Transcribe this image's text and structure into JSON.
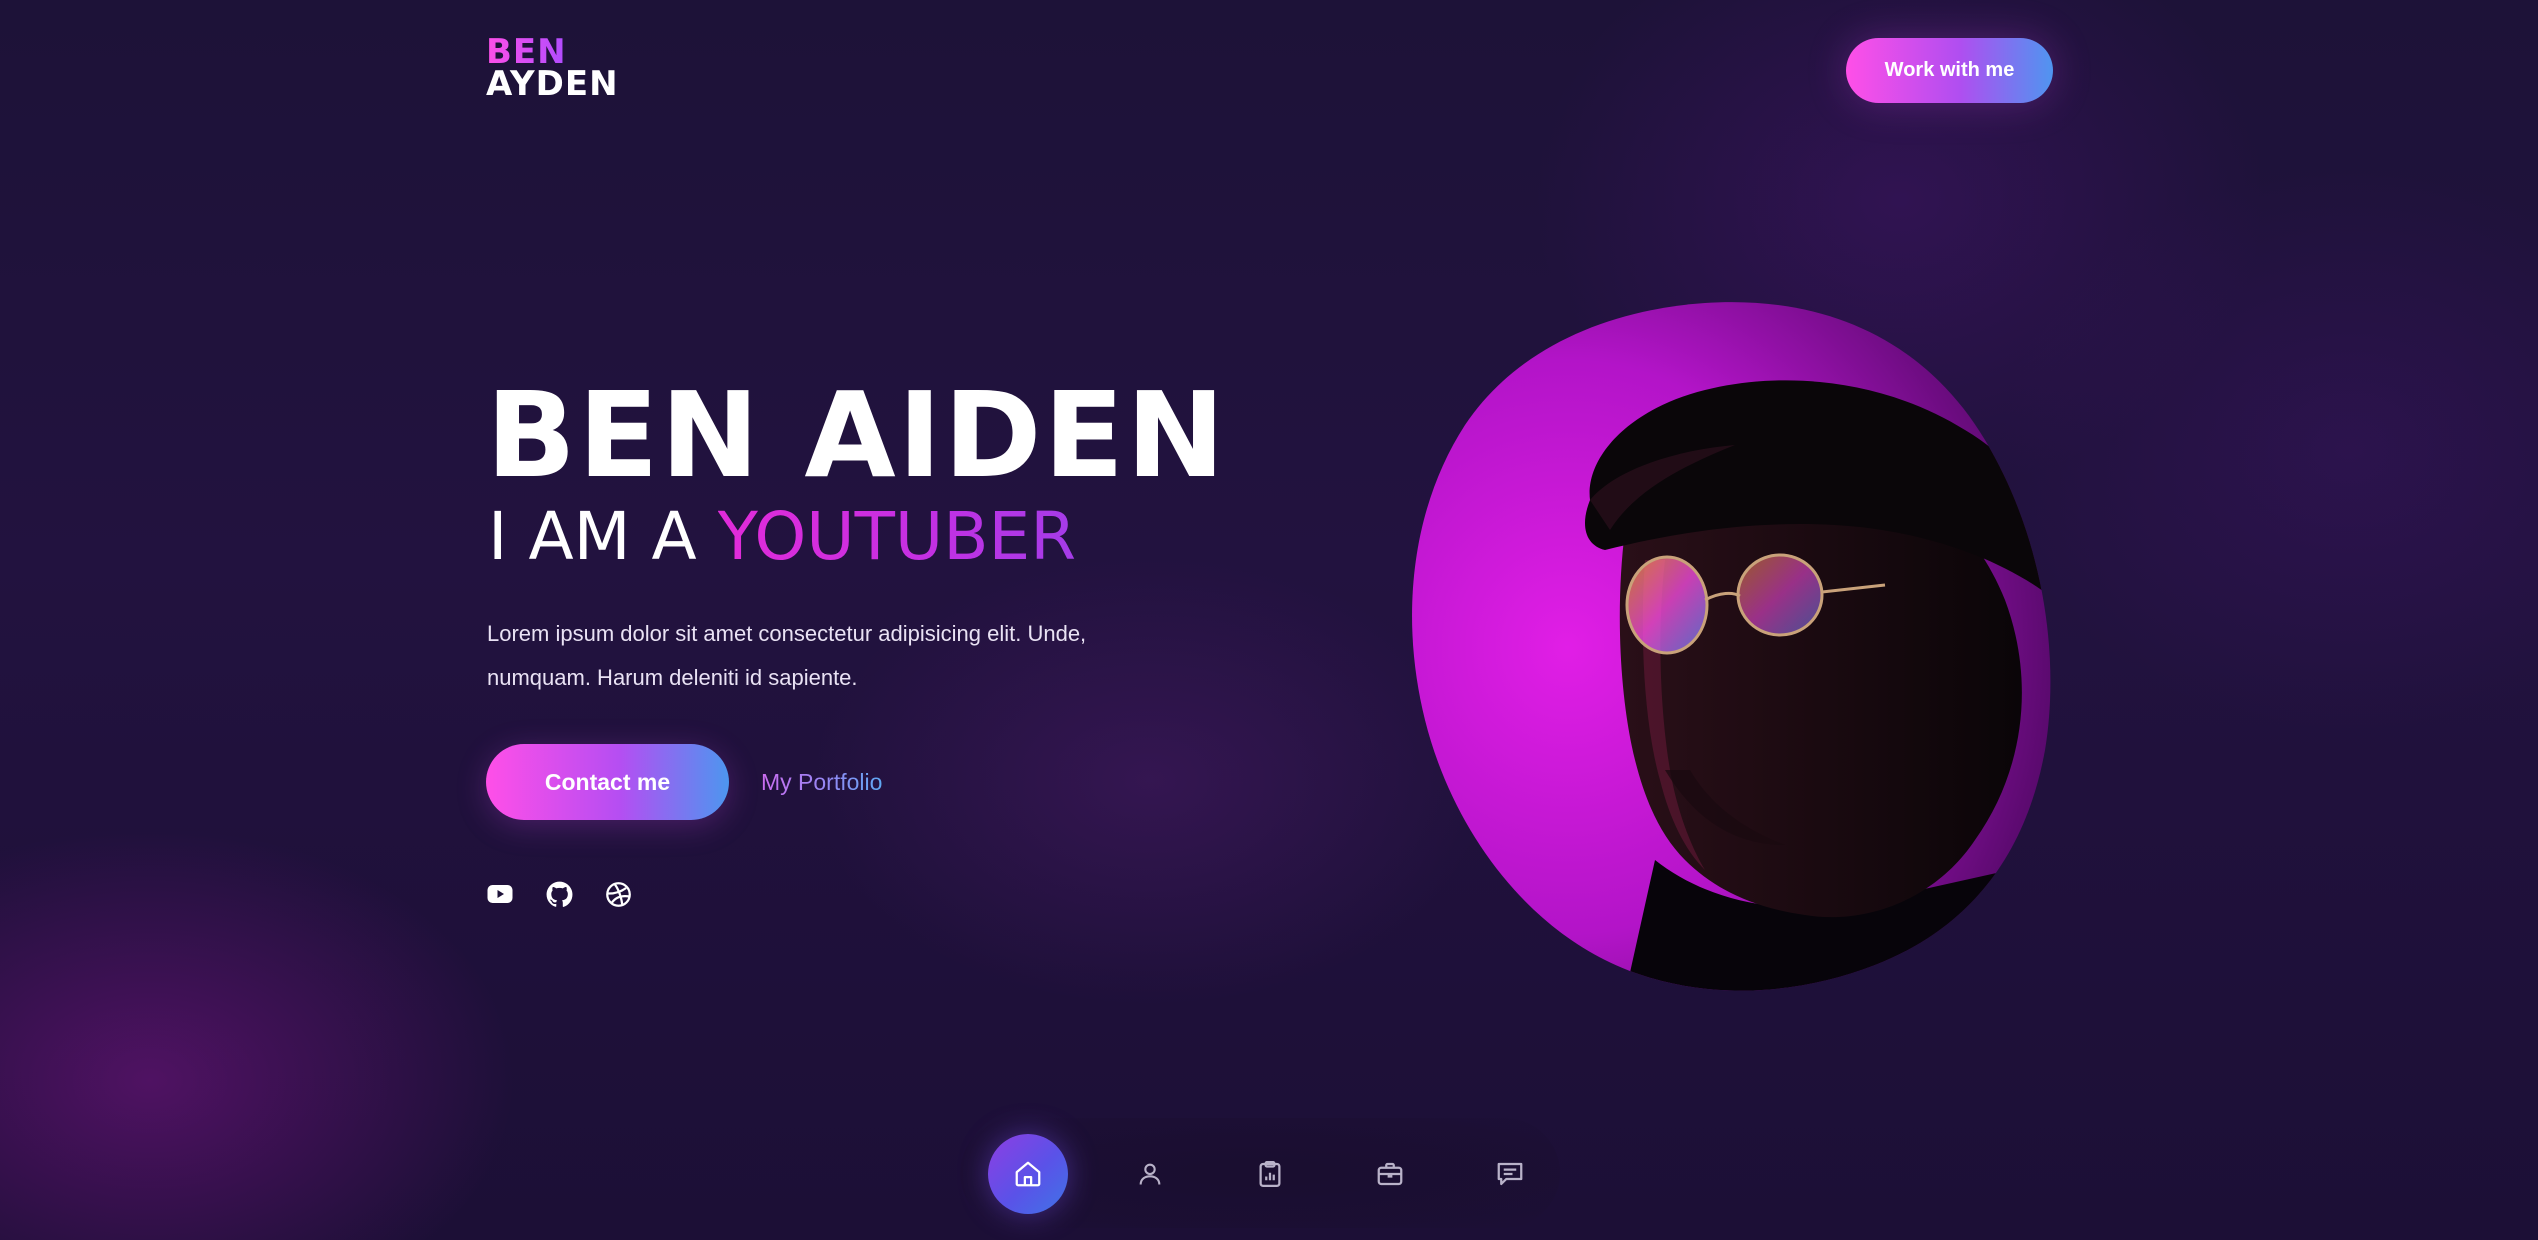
{
  "logo": {
    "line1": "BEN",
    "line2": "AYDEN"
  },
  "header": {
    "cta_label": "Work with me"
  },
  "hero": {
    "name": "BEN AIDEN",
    "role_prefix": "I AM A ",
    "role_accent": "YOUTUBER",
    "description_line1": "Lorem ipsum dolor sit amet consectetur adipisicing elit. Unde,",
    "description_line2": "numquam. Harum deleniti id sapiente.",
    "primary_button": "Contact me",
    "secondary_link": "My Portfolio"
  },
  "socials": [
    {
      "icon": "youtube-icon"
    },
    {
      "icon": "github-icon"
    },
    {
      "icon": "dribbble-icon"
    }
  ],
  "bottom_nav": [
    {
      "icon": "home-icon",
      "active": true
    },
    {
      "icon": "user-icon",
      "active": false
    },
    {
      "icon": "clipboard-icon",
      "active": false
    },
    {
      "icon": "briefcase-icon",
      "active": false
    },
    {
      "icon": "message-icon",
      "active": false
    }
  ],
  "colors": {
    "background": "#1d1238",
    "accent_pink": "#ff4fe8",
    "accent_purple": "#c330e3",
    "accent_blue": "#4f95f0",
    "text": "#ffffff"
  }
}
